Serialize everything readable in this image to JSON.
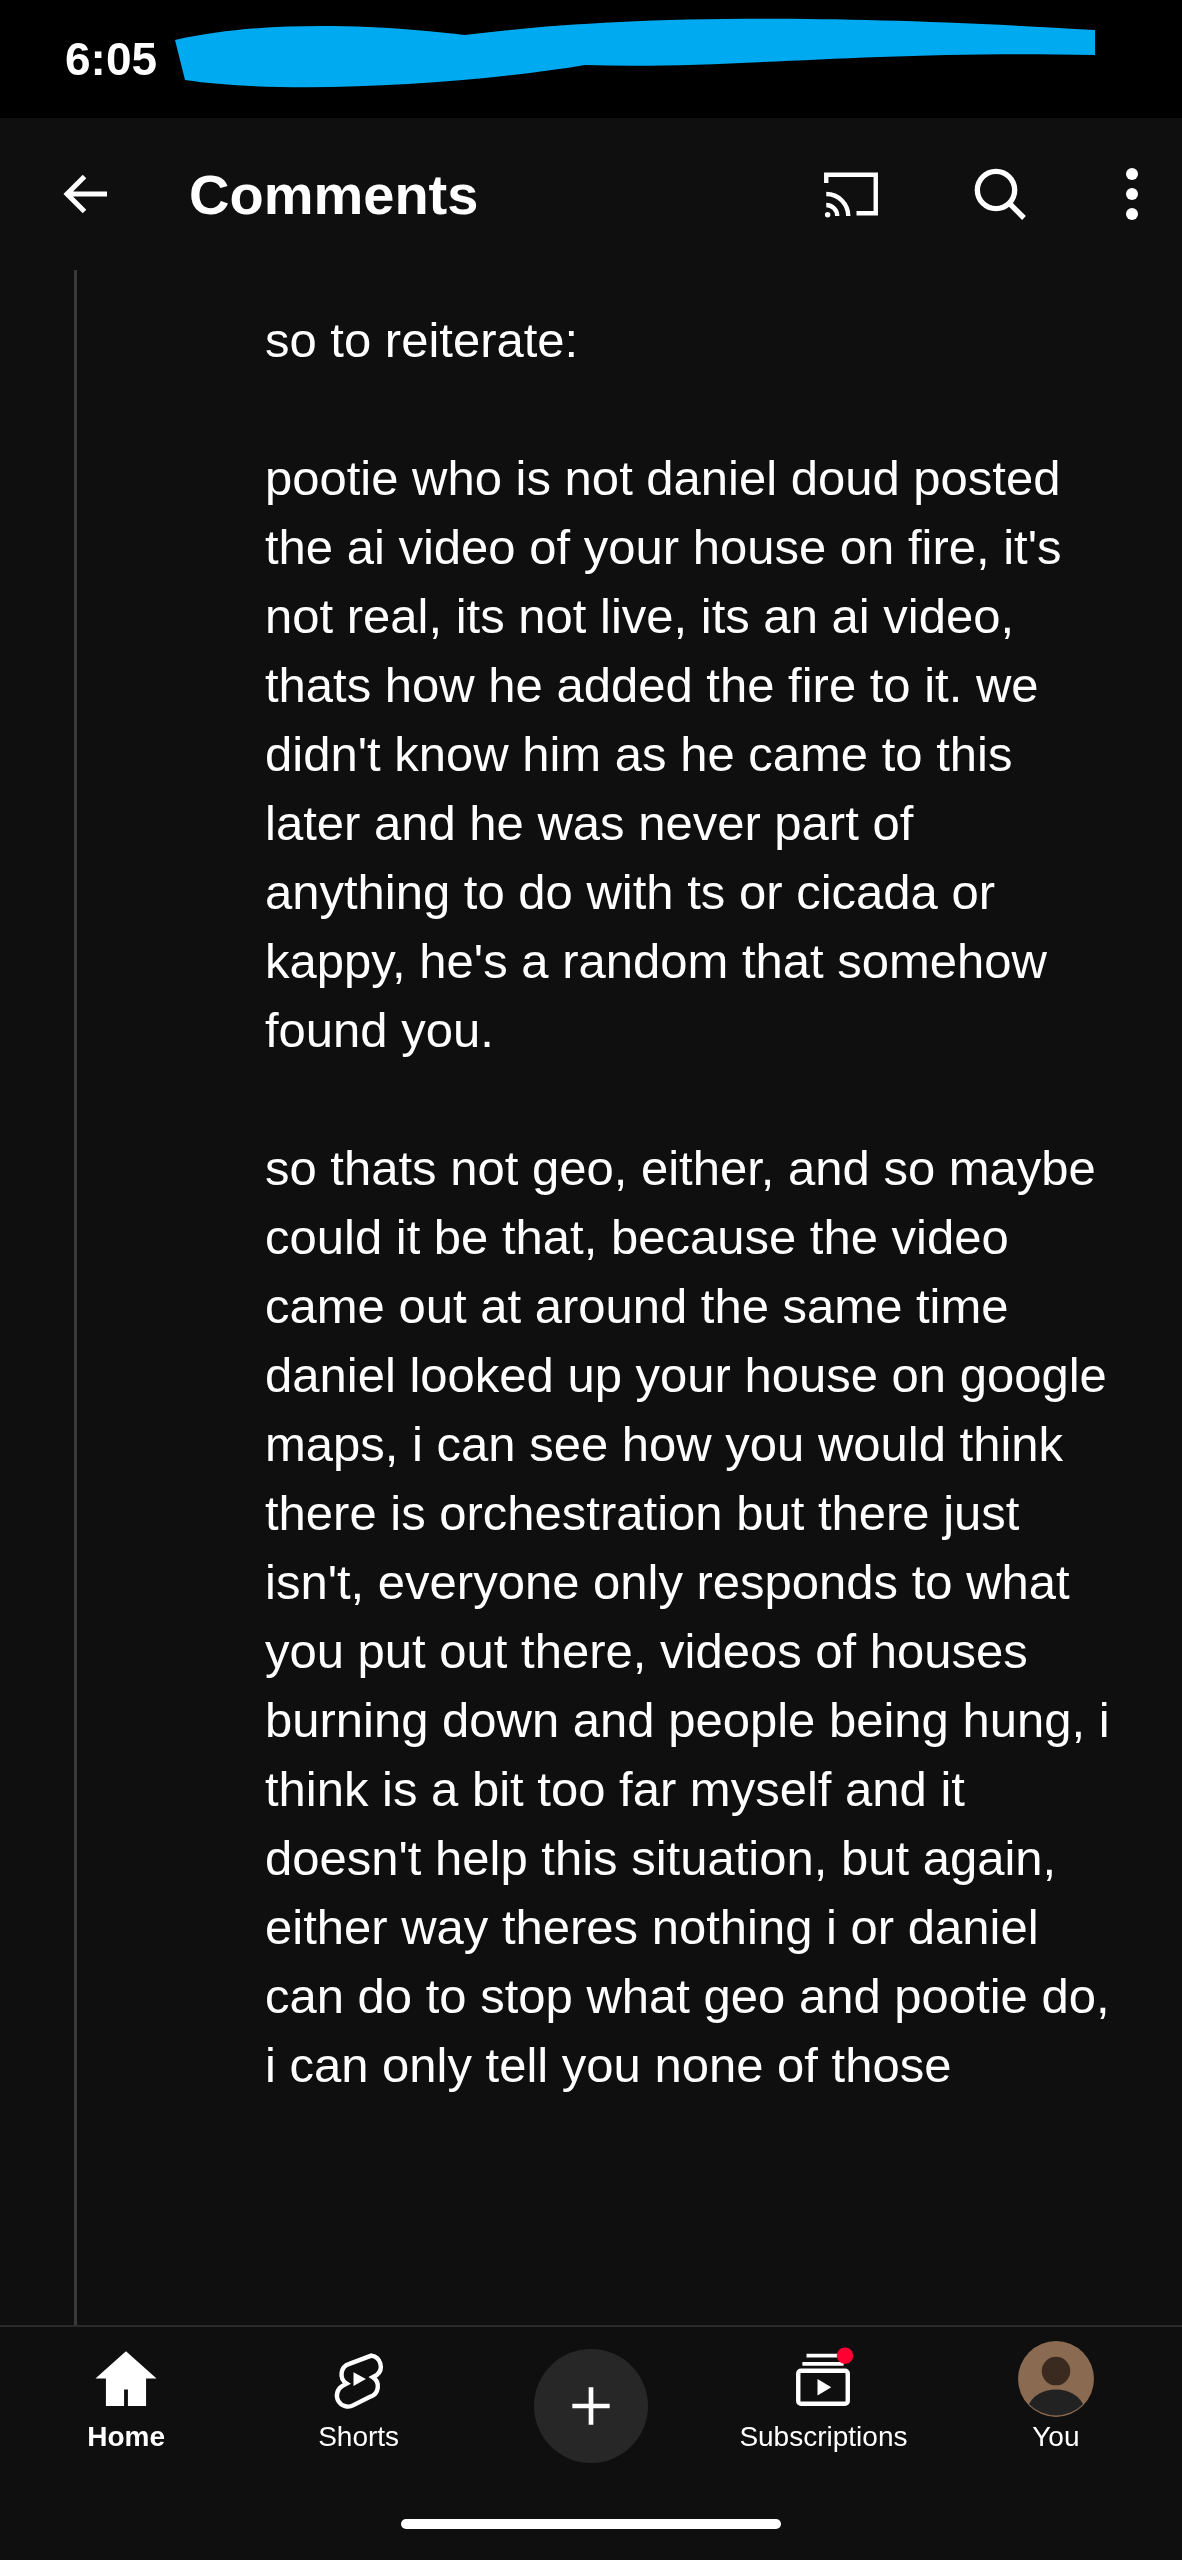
{
  "status_bar": {
    "time": "6:05"
  },
  "header": {
    "title": "Comments"
  },
  "comment": {
    "paragraphs": [
      "so to reiterate:",
      "pootie who is not daniel doud posted the ai video of your house on fire, it's not real, its not live, its an ai video, thats how he added the fire to it. we didn't know him as he came to this later and he was never part of anything to do with ts or cicada or kappy, he's a random that somehow found you.",
      "so thats not geo, either, and so maybe could it be that, because the video came out at around the same time daniel looked up your house on google maps, i can see how you would think there is orchestration but there just isn't, everyone only responds to what you put out there, videos of houses burning down and people being hung, i think is a bit too far myself and it doesn't help this situation, but again, either way theres nothing i or daniel can do to stop what geo and pootie do, i can only tell you none of those"
    ]
  },
  "nav": [
    {
      "kind": "home",
      "label": "Home",
      "selected": true
    },
    {
      "kind": "shorts",
      "label": "Shorts",
      "selected": false
    },
    {
      "kind": "create",
      "selected": false
    },
    {
      "kind": "subscriptions",
      "label": "Subscriptions",
      "selected": false,
      "notification_dot": true
    },
    {
      "kind": "you",
      "label": "You",
      "selected": false
    }
  ]
}
